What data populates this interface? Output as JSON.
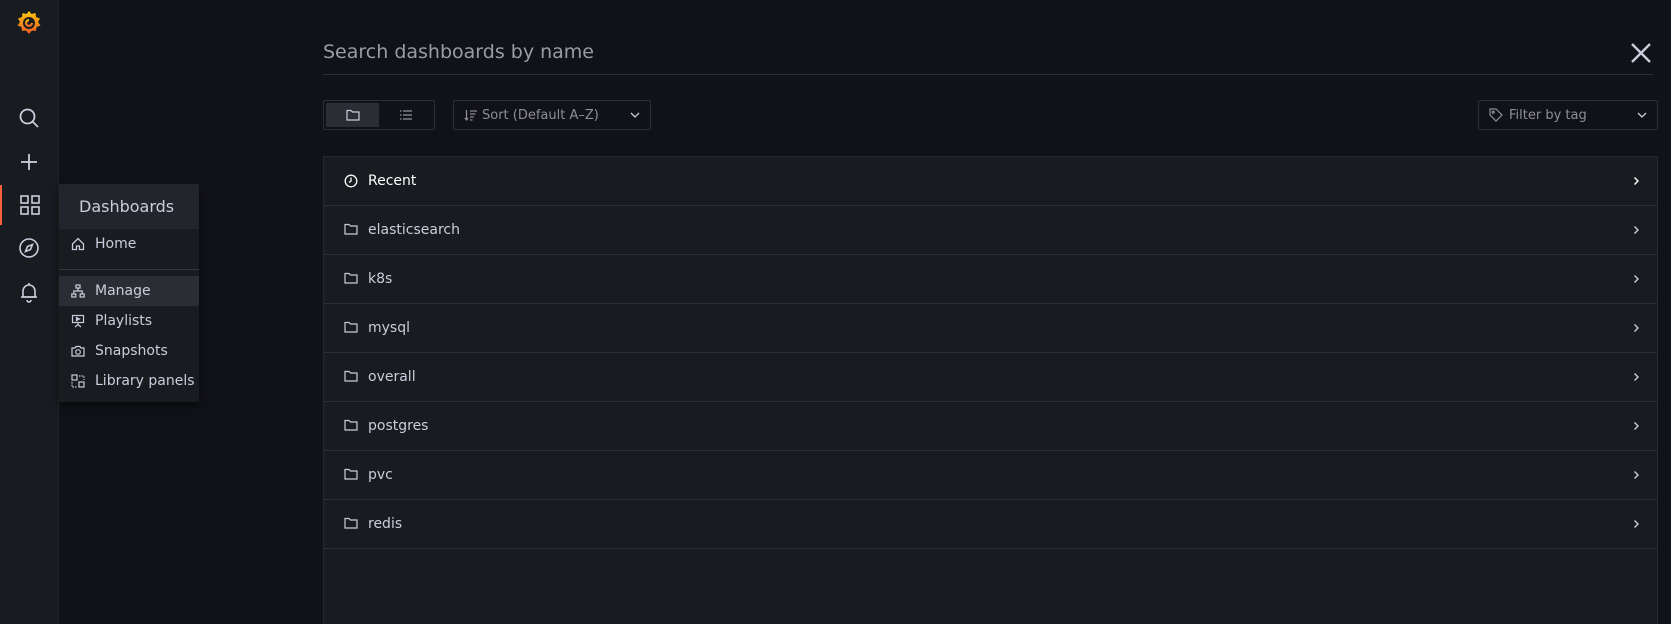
{
  "search": {
    "placeholder": "Search dashboards by name",
    "value": ""
  },
  "sidebar": {
    "items": [
      {
        "name": "search",
        "icon": "search-icon"
      },
      {
        "name": "create",
        "icon": "plus-icon"
      },
      {
        "name": "dashboards",
        "icon": "apps-icon",
        "active": true
      },
      {
        "name": "explore",
        "icon": "compass-icon"
      },
      {
        "name": "alerting",
        "icon": "bell-icon"
      }
    ]
  },
  "dashboards_menu": {
    "title": "Dashboards",
    "items": [
      {
        "label": "Home",
        "icon": "home-icon"
      },
      {
        "label": "Manage",
        "icon": "sitemap-icon",
        "selected": true
      },
      {
        "label": "Playlists",
        "icon": "presentation-icon"
      },
      {
        "label": "Snapshots",
        "icon": "camera-icon"
      },
      {
        "label": "Library panels",
        "icon": "library-panel-icon"
      }
    ]
  },
  "toolbar": {
    "view_folder_icon": "folder-icon",
    "view_list_icon": "list-icon",
    "sort_label": "Sort (Default A–Z)",
    "tag_filter_placeholder": "Filter by tag"
  },
  "folders": [
    {
      "label": "Recent",
      "icon": "clock-icon"
    },
    {
      "label": "elasticsearch",
      "icon": "folder-icon"
    },
    {
      "label": "k8s",
      "icon": "folder-icon"
    },
    {
      "label": "mysql",
      "icon": "folder-icon"
    },
    {
      "label": "overall",
      "icon": "folder-icon"
    },
    {
      "label": "postgres",
      "icon": "folder-icon"
    },
    {
      "label": "pvc",
      "icon": "folder-icon"
    },
    {
      "label": "redis",
      "icon": "folder-icon"
    }
  ],
  "colors": {
    "background": "#111217",
    "sidebar": "#181b1f",
    "accent": "#f55f3e",
    "text": "#ccccdc"
  }
}
